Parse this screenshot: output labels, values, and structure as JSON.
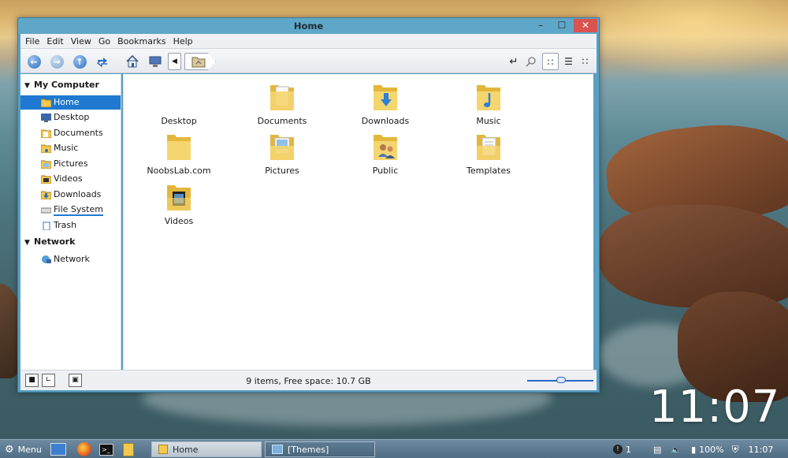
{
  "window": {
    "title": "Home",
    "controls": {
      "minimize": "–",
      "maximize": "☐",
      "close": "✕"
    }
  },
  "menubar": [
    "File",
    "Edit",
    "View",
    "Go",
    "Bookmarks",
    "Help"
  ],
  "toolbar": {
    "icons": [
      "back-icon",
      "forward-icon",
      "up-icon",
      "reload-icon",
      "home-icon",
      "computer-icon"
    ],
    "breadcrumb_icon": "folder-home-icon",
    "right_icons": [
      "toggle-location-icon",
      "search-icon",
      "icon-view-icon",
      "list-view-icon",
      "compact-view-icon"
    ]
  },
  "sidebar": {
    "sections": [
      {
        "header": "My Computer",
        "items": [
          {
            "label": "Home",
            "icon": "home-folder-icon",
            "selected": true
          },
          {
            "label": "Desktop",
            "icon": "desktop-icon"
          },
          {
            "label": "Documents",
            "icon": "documents-folder-icon"
          },
          {
            "label": "Music",
            "icon": "music-folder-icon"
          },
          {
            "label": "Pictures",
            "icon": "pictures-folder-icon"
          },
          {
            "label": "Videos",
            "icon": "videos-folder-icon"
          },
          {
            "label": "Downloads",
            "icon": "downloads-folder-icon"
          },
          {
            "label": "File System",
            "icon": "drive-icon"
          },
          {
            "label": "Trash",
            "icon": "trash-icon"
          }
        ]
      },
      {
        "header": "Network",
        "items": [
          {
            "label": "Network",
            "icon": "network-icon"
          }
        ]
      }
    ]
  },
  "files": [
    {
      "label": "Desktop",
      "icon": "desktop-icon"
    },
    {
      "label": "Documents",
      "icon": "documents-folder-icon"
    },
    {
      "label": "Downloads",
      "icon": "downloads-folder-icon"
    },
    {
      "label": "Music",
      "icon": "music-folder-icon"
    },
    {
      "label": "NoobsLab.com",
      "icon": "folder-icon"
    },
    {
      "label": "Pictures",
      "icon": "pictures-folder-icon"
    },
    {
      "label": "Public",
      "icon": "public-folder-icon"
    },
    {
      "label": "Templates",
      "icon": "templates-folder-icon"
    },
    {
      "label": "Videos",
      "icon": "videos-folder-icon"
    }
  ],
  "statusbar": {
    "text": "9 items, Free space: 10.7 GB"
  },
  "desktop_clock": "11:07",
  "taskbar": {
    "menu_label": "Menu",
    "tasks": [
      {
        "label": "Home",
        "active": true
      },
      {
        "label": "[Themes]",
        "active": false
      }
    ],
    "tray": {
      "notifications": "1",
      "battery": "100%",
      "time": "11:07"
    }
  },
  "colors": {
    "selection": "#1f79d1",
    "window_frame": "#5fa7c8",
    "taskbar": "#5a778d",
    "folder": "#f2c94c"
  }
}
